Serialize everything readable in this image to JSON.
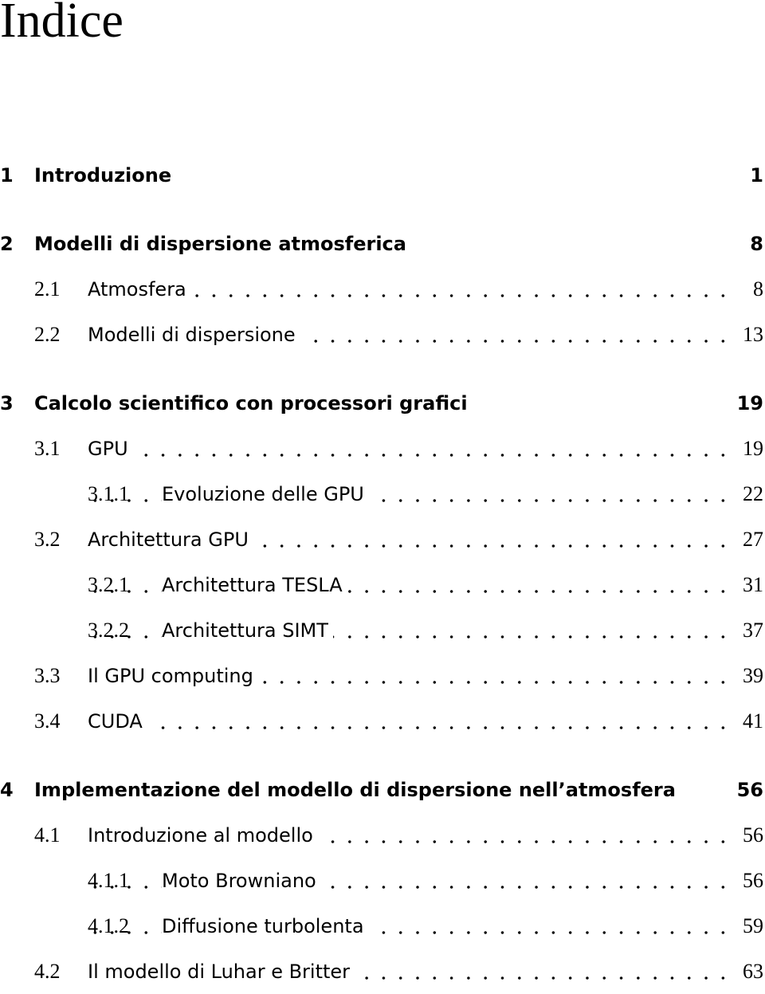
{
  "title": "Indice",
  "entries": [
    {
      "level": "chapter",
      "number": "1",
      "label": "Introduzione",
      "page": "1"
    },
    {
      "level": "chapter",
      "number": "2",
      "label": "Modelli di dispersione atmosferica",
      "page": "8"
    },
    {
      "level": "section",
      "number": "2.1",
      "label": "Atmosfera",
      "page": "8"
    },
    {
      "level": "section",
      "number": "2.2",
      "label": "Modelli di dispersione",
      "page": "13"
    },
    {
      "level": "chapter",
      "number": "3",
      "label": "Calcolo scientifico con processori grafici",
      "page": "19"
    },
    {
      "level": "section",
      "number": "3.1",
      "label": "GPU",
      "page": "19"
    },
    {
      "level": "subsection",
      "number": "3.1.1",
      "label": "Evoluzione delle GPU",
      "page": "22"
    },
    {
      "level": "section",
      "number": "3.2",
      "label": "Architettura GPU",
      "page": "27"
    },
    {
      "level": "subsection",
      "number": "3.2.1",
      "label": "Architettura TESLA",
      "page": "31"
    },
    {
      "level": "subsection",
      "number": "3.2.2",
      "label": "Architettura SIMT",
      "page": "37"
    },
    {
      "level": "section",
      "number": "3.3",
      "label": "Il GPU computing",
      "page": "39"
    },
    {
      "level": "section",
      "number": "3.4",
      "label": "CUDA",
      "page": "41"
    },
    {
      "level": "chapter",
      "number": "4",
      "label": "Implementazione del modello di dispersione nell’atmosfera",
      "page": "56"
    },
    {
      "level": "section",
      "number": "4.1",
      "label": "Introduzione al modello",
      "page": "56"
    },
    {
      "level": "subsection",
      "number": "4.1.1",
      "label": "Moto Browniano",
      "page": "56"
    },
    {
      "level": "subsection",
      "number": "4.1.2",
      "label": "Diffusione turbolenta",
      "page": "59"
    },
    {
      "level": "section",
      "number": "4.2",
      "label": "Il modello di Luhar e Britter",
      "page": "63"
    }
  ]
}
